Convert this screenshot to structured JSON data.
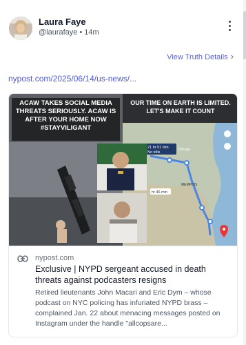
{
  "post": {
    "author_name": "Laura Faye",
    "handle": "@laurafaye",
    "separator": "•",
    "time": "14m",
    "view_details_label": "View Truth Details",
    "url_text": "nypost.com/2025/06/14/us-news/..."
  },
  "card": {
    "image_left_caption": "ACAW TAKES SOCIAL MEDIA THREATS SERIOUSLY. ACAW IS AFTER YOUR HOME NOW #STAYVILIGANT",
    "image_right_caption": "OUR TIME ON EARTH IS LIMITED. LET'S MAKE IT COUNT",
    "map_badge_1": "21 hr 51 min",
    "map_badge_2": "No tolls",
    "map_badge_3": "hr 46 min",
    "map_label_chicago": "Chicago",
    "map_label_memphis": "MEMPHIS",
    "domain": "nypost.com",
    "title": "Exclusive | NYPD sergeant accused in death threats against podcasters resigns",
    "description": "Retired lieutenants John Macari and Eric Dym – whose podcast on NYC policing has infuriated NYPD brass – complained Jan. 22 about menacing messages posted on Instagram under the handle \"allcopsare..."
  },
  "icons": {
    "more": "vertical-ellipsis-icon",
    "chevron": "chevron-right-icon",
    "link": "link-icon",
    "location": "location-pin-icon"
  },
  "colors": {
    "accent": "#5a63d8",
    "map_route": "#4a86e8",
    "map_pin": "#e53935"
  }
}
